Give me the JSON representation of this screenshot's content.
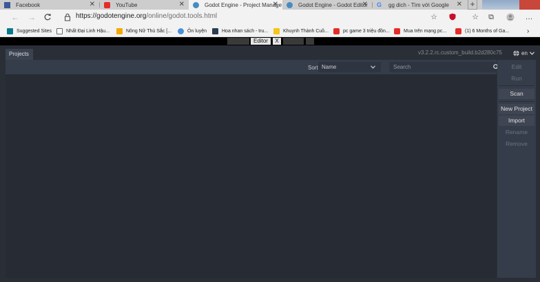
{
  "browser": {
    "tabs": [
      {
        "label": "Facebook",
        "favicon": "facebook-icon",
        "color": "#3b5998"
      },
      {
        "label": "YouTube",
        "favicon": "youtube-icon",
        "color": "#e52d27"
      },
      {
        "label": "Godot Engine - Project Manage",
        "favicon": "godot-icon",
        "color": "#478cbf"
      },
      {
        "label": "Godot Engine - Godot Editor",
        "favicon": "godot-icon",
        "color": "#478cbf"
      },
      {
        "label": "gg dich - Tìm với Google",
        "favicon": "google-icon",
        "color": "#4285f4"
      }
    ],
    "new_tab": "+",
    "close_glyph": "✕",
    "url_host": "https://godotengine.org",
    "url_path": "/online/godot.tools.html"
  },
  "favorites": [
    {
      "label": "Suggested Sites",
      "icon": "suggested-sites-icon",
      "color": "#0a7a8a"
    },
    {
      "label": "Nhất Đại Linh Hậu...",
      "icon": "page-icon",
      "color": "#ffffff"
    },
    {
      "label": "Nông Nữ Thù Sắc [...",
      "icon": "logo-icon",
      "color": "#f2a900"
    },
    {
      "label": "Ôn luyện",
      "icon": "site-icon",
      "color": "#4a90d9"
    },
    {
      "label": "Hoa nhan sách - tru...",
      "icon": "site-icon",
      "color": "#2c3e50"
    },
    {
      "label": "Khuynh Thành Cuồ...",
      "icon": "site-icon",
      "color": "#f5c518"
    },
    {
      "label": "pc game 3 triệu đồn...",
      "icon": "youtube-icon",
      "color": "#e52d27"
    },
    {
      "label": "Mua trên mạng pc...",
      "icon": "youtube-icon",
      "color": "#e52d27"
    },
    {
      "label": "(1) 6 Months of Ga...",
      "icon": "youtube-icon",
      "color": "#e52d27"
    }
  ],
  "overlay": {
    "editor_label": "Editor",
    "close_label": "X"
  },
  "pm": {
    "projects_tab": "Projects",
    "version": "v3.2.2.rc.custom_build.b2d280c75",
    "language": "en",
    "sort_label": "Sort:",
    "sort_value": "Name",
    "search_placeholder": "Search",
    "buttons": {
      "edit": "Edit",
      "run": "Run",
      "scan": "Scan",
      "new_project": "New Project",
      "import": "Import",
      "rename": "Rename",
      "remove": "Remove"
    }
  },
  "colors": {
    "editor_bg": "#2a2e37",
    "panel": "#363d4a",
    "accent": "#478cbf"
  }
}
